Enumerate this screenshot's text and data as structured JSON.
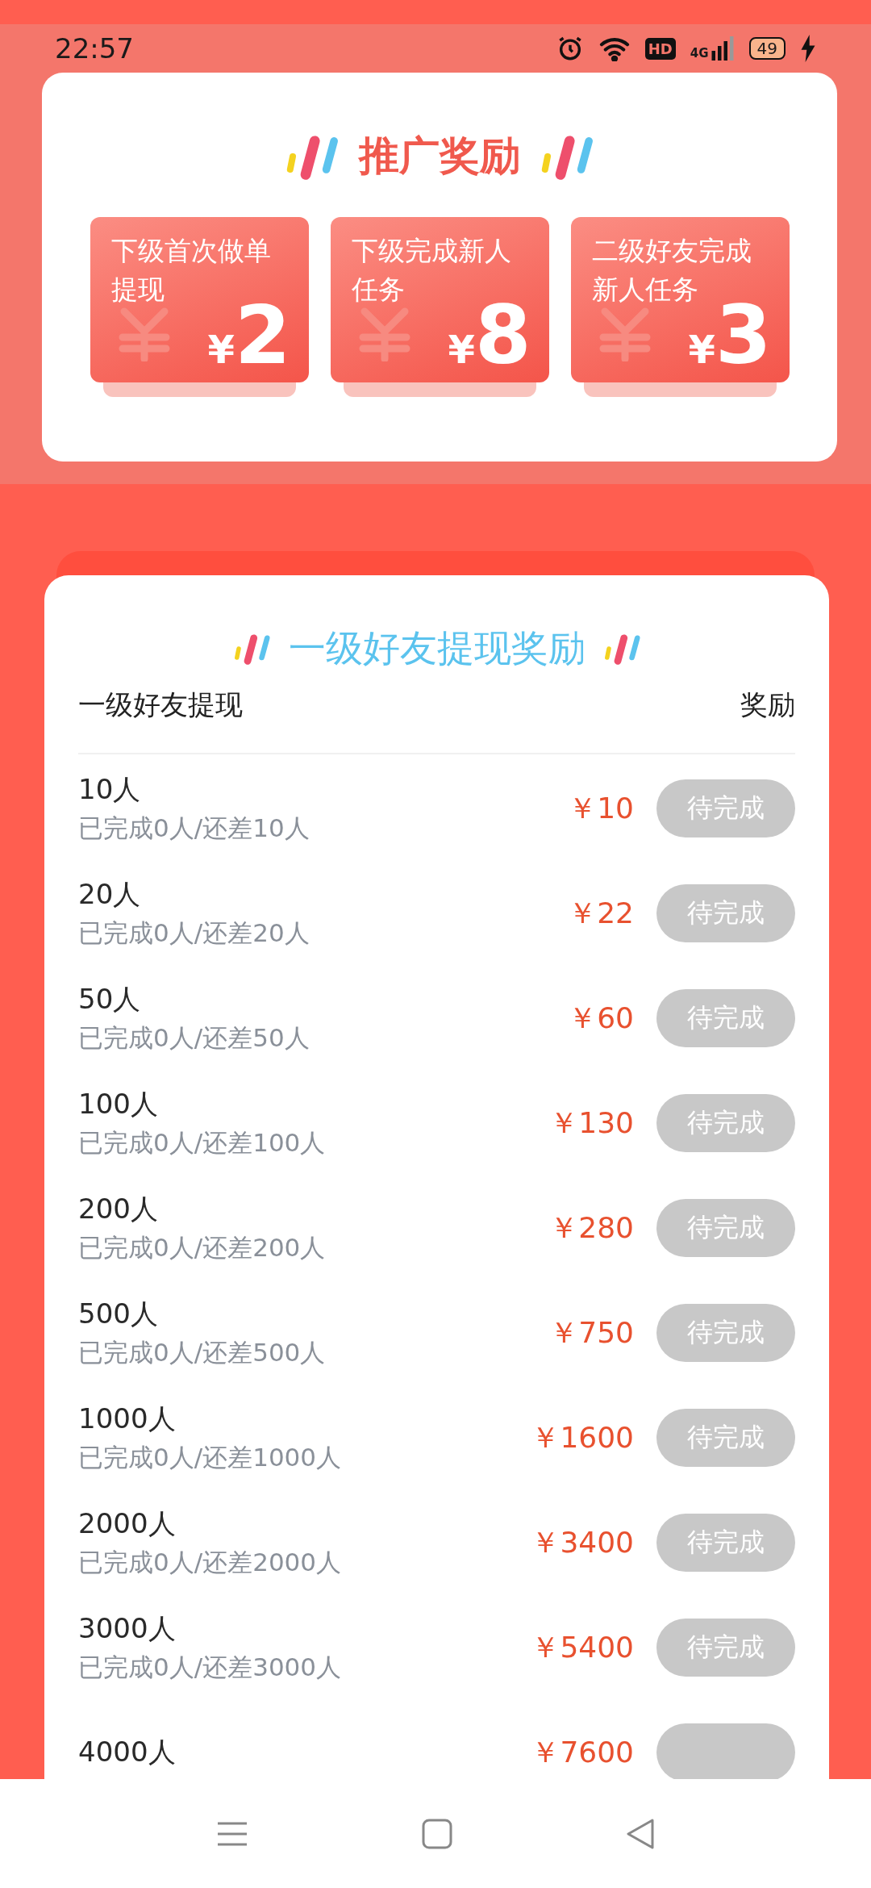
{
  "status_bar": {
    "time": "22:57",
    "hd": "HD",
    "network": "4G",
    "battery": "49"
  },
  "promo": {
    "title": "推广奖励",
    "tiles": [
      {
        "label": "下级首次做单提现",
        "currency": "¥",
        "amount": "2"
      },
      {
        "label": "下级完成新人任务",
        "currency": "¥",
        "amount": "8"
      },
      {
        "label": "二级好友完成新人任务",
        "currency": "¥",
        "amount": "3"
      }
    ]
  },
  "rewards": {
    "title": "一级好友提现奖励",
    "columns": [
      "一级好友提现",
      "奖励"
    ],
    "rows": [
      {
        "label": "10人",
        "progress": "已完成0人/还差10人",
        "reward": "￥10",
        "button": "待完成",
        "disabled": true
      },
      {
        "label": "20人",
        "progress": "已完成0人/还差20人",
        "reward": "￥22",
        "button": "待完成",
        "disabled": true
      },
      {
        "label": "50人",
        "progress": "已完成0人/还差50人",
        "reward": "￥60",
        "button": "待完成",
        "disabled": true
      },
      {
        "label": "100人",
        "progress": "已完成0人/还差100人",
        "reward": "￥130",
        "button": "待完成",
        "disabled": true
      },
      {
        "label": "200人",
        "progress": "已完成0人/还差200人",
        "reward": "￥280",
        "button": "待完成",
        "disabled": true
      },
      {
        "label": "500人",
        "progress": "已完成0人/还差500人",
        "reward": "￥750",
        "button": "待完成",
        "disabled": true
      },
      {
        "label": "1000人",
        "progress": "已完成0人/还差1000人",
        "reward": "￥1600",
        "button": "待完成",
        "disabled": true
      },
      {
        "label": "2000人",
        "progress": "已完成0人/还差2000人",
        "reward": "￥3400",
        "button": "待完成",
        "disabled": true
      },
      {
        "label": "3000人",
        "progress": "已完成0人/还差3000人",
        "reward": "￥5400",
        "button": "待完成",
        "disabled": true
      },
      {
        "label": "4000人",
        "reward": "￥7600",
        "disabled": true
      }
    ]
  }
}
